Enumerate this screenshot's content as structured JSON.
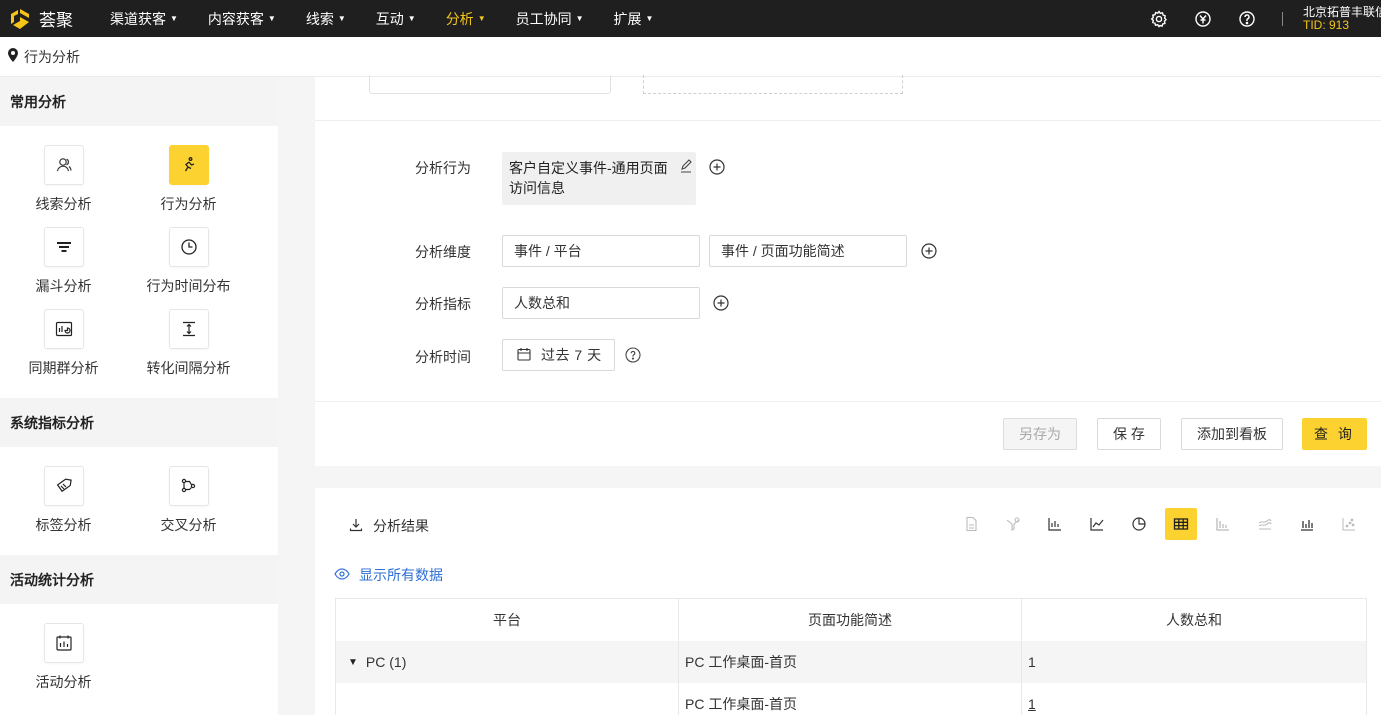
{
  "app": {
    "logo_text": "荟聚"
  },
  "nav": {
    "items": [
      {
        "label": "渠道获客",
        "active": false
      },
      {
        "label": "内容获客",
        "active": false
      },
      {
        "label": "线索",
        "active": false
      },
      {
        "label": "互动",
        "active": false
      },
      {
        "label": "分析",
        "active": true
      },
      {
        "label": "员工协同",
        "active": false
      },
      {
        "label": "扩展",
        "active": false
      }
    ],
    "right_icons": [
      "settings-icon",
      "currency-icon",
      "help-icon"
    ],
    "tenant_name": "北京拓普丰联信",
    "tenant_tid": "TID: 913"
  },
  "breadcrumb": {
    "label": "行为分析"
  },
  "sidebar": {
    "sections": [
      {
        "title": "常用分析",
        "items": [
          {
            "label": "线索分析",
            "icon": "user-icon",
            "active": false
          },
          {
            "label": "行为分析",
            "icon": "behavior-icon",
            "active": true
          },
          {
            "label": "漏斗分析",
            "icon": "funnel-icon",
            "active": false
          },
          {
            "label": "行为时间分布",
            "icon": "clock-icon",
            "active": false
          },
          {
            "label": "同期群分析",
            "icon": "cohort-icon",
            "active": false
          },
          {
            "label": "转化间隔分析",
            "icon": "interval-icon",
            "active": false
          }
        ]
      },
      {
        "title": "系统指标分析",
        "items": [
          {
            "label": "标签分析",
            "icon": "tag-icon",
            "active": false
          },
          {
            "label": "交叉分析",
            "icon": "cross-icon",
            "active": false
          }
        ]
      },
      {
        "title": "活动统计分析",
        "items": [
          {
            "label": "活动分析",
            "icon": "calendar-icon",
            "active": false
          }
        ]
      }
    ]
  },
  "form": {
    "behavior_label": "分析行为",
    "behavior_value": "客户自定义事件-通用页面访问信息",
    "dimension_label": "分析维度",
    "dimensions": [
      "事件 / 平台",
      "事件 / 页面功能简述"
    ],
    "metric_label": "分析指标",
    "metric_value": "人数总和",
    "time_label": "分析时间",
    "time_value": "过去 7 天",
    "buttons": {
      "save_as": "另存为",
      "save": "保 存",
      "add_to_board": "添加到看板",
      "query": "查 询"
    }
  },
  "results": {
    "title": "分析结果",
    "show_all": "显示所有数据",
    "chart_types": [
      "number-card-icon",
      "funnel-chart-icon",
      "bar-chart-icon",
      "line-chart-icon",
      "pie-chart-icon",
      "table-icon",
      "stacked-bar-icon",
      "area-chart-icon",
      "grouped-bar-icon",
      "scatter-icon"
    ],
    "active_chart_type": "table-icon",
    "columns": [
      "平台",
      "页面功能简述",
      "人数总和"
    ],
    "rows": [
      {
        "platform": "PC (1)",
        "page": "PC 工作桌面-首页",
        "count": "1",
        "group": true
      },
      {
        "platform": "",
        "page": "PC 工作桌面-首页",
        "count": "1",
        "group": false
      }
    ]
  },
  "colors": {
    "accent": "#fcd230",
    "nav_bg": "#1f1f1f",
    "link": "#2f6fd6",
    "nav_active": "#f5c518"
  }
}
